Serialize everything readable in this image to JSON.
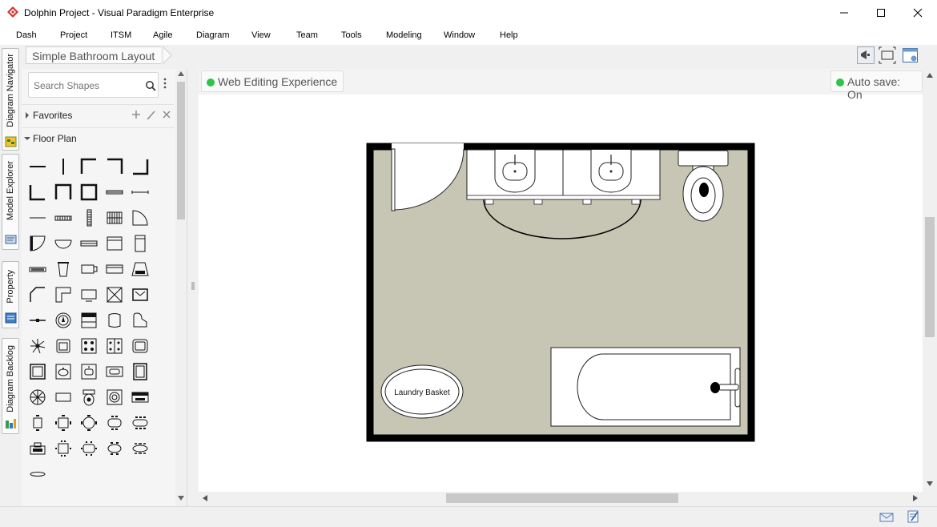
{
  "window": {
    "title": "Dolphin Project - Visual Paradigm Enterprise",
    "brand_color": "#d9312b"
  },
  "menu": [
    "Dash",
    "Project",
    "ITSM",
    "Agile",
    "Diagram",
    "View",
    "Team",
    "Tools",
    "Modeling",
    "Window",
    "Help"
  ],
  "side_tabs": [
    {
      "label": "Diagram Navigator",
      "icon": "diagram-navigator-icon"
    },
    {
      "label": "Model Explorer",
      "icon": "model-explorer-icon"
    },
    {
      "label": "Property",
      "icon": "property-icon"
    },
    {
      "label": "Diagram Backlog",
      "icon": "diagram-backlog-icon"
    }
  ],
  "breadcrumb": {
    "diagram_name": "Simple Bathroom Layout"
  },
  "toolbar_icons": [
    "announce-icon",
    "fit-diagram-icon",
    "panel-layout-icon"
  ],
  "shapes_panel": {
    "search_placeholder": "Search Shapes",
    "sections": [
      {
        "label": "Favorites",
        "expanded": false
      },
      {
        "label": "Floor Plan",
        "expanded": true
      }
    ]
  },
  "canvas": {
    "web_editing_label": "Web Editing Experience",
    "autosave_label": "Auto save: On",
    "status_color": "#2ec44a",
    "floor_color": "#c7c6b4",
    "laundry_basket_label": "Laundry Basket"
  },
  "status_icons": [
    "mail-icon",
    "notes-icon"
  ]
}
